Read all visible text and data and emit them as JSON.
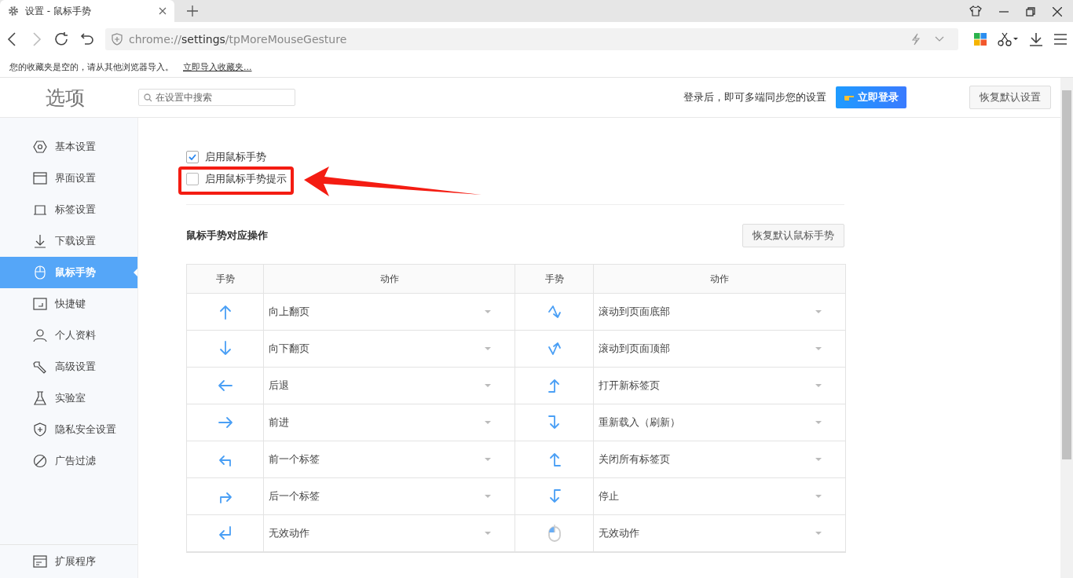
{
  "tab": {
    "title": "设置 - 鼠标手势"
  },
  "address": {
    "scheme": "chrome://",
    "host": "settings",
    "path": "/tpMoreMouseGesture"
  },
  "bookmarks_bar": {
    "message": "您的收藏夹是空的，请从其他浏览器导入。",
    "link": "立即导入收藏夹..."
  },
  "header": {
    "title": "选项",
    "search_placeholder": "在设置中搜索",
    "sync_text": "登录后，即可多端同步您的设置",
    "login_button": "立即登录",
    "reset_button": "恢复默认设置"
  },
  "sidebar": {
    "items": [
      {
        "label": "基本设置",
        "kind": "gear",
        "selected": false
      },
      {
        "label": "界面设置",
        "kind": "window",
        "selected": false
      },
      {
        "label": "标签设置",
        "kind": "tab",
        "selected": false
      },
      {
        "label": "下载设置",
        "kind": "download",
        "selected": false
      },
      {
        "label": "鼠标手势",
        "kind": "mouse",
        "selected": true
      },
      {
        "label": "快捷键",
        "kind": "keyboard",
        "selected": false
      },
      {
        "label": "个人资料",
        "kind": "user",
        "selected": false
      },
      {
        "label": "高级设置",
        "kind": "wrench",
        "selected": false
      },
      {
        "label": "实验室",
        "kind": "flask",
        "selected": false
      },
      {
        "label": "隐私安全设置",
        "kind": "shield",
        "selected": false
      },
      {
        "label": "广告过滤",
        "kind": "block",
        "selected": false
      }
    ],
    "footer": {
      "label": "扩展程序",
      "kind": "extension"
    }
  },
  "options": [
    {
      "label": "启用鼠标手势",
      "checked": true,
      "highlighted": false
    },
    {
      "label": "启用鼠标手势提示",
      "checked": false,
      "highlighted": true
    }
  ],
  "gestures": {
    "title": "鼠标手势对应操作",
    "reset_button": "恢复默认鼠标手势",
    "columns": [
      "手势",
      "动作",
      "手势",
      "动作"
    ],
    "rows": [
      [
        {
          "kind": "up",
          "action": "向上翻页"
        },
        {
          "kind": "zigzag-down",
          "action": "滚动到页面底部"
        }
      ],
      [
        {
          "kind": "down",
          "action": "向下翻页"
        },
        {
          "kind": "zigzag-up",
          "action": "滚动到页面顶部"
        }
      ],
      [
        {
          "kind": "left",
          "action": "后退"
        },
        {
          "kind": "right-up",
          "action": "打开新标签页"
        }
      ],
      [
        {
          "kind": "right",
          "action": "前进"
        },
        {
          "kind": "right-down",
          "action": "重新载入（刷新）"
        }
      ],
      [
        {
          "kind": "up-left",
          "action": "前一个标签"
        },
        {
          "kind": "left-up",
          "action": "关闭所有标签页"
        }
      ],
      [
        {
          "kind": "up-right",
          "action": "后一个标签"
        },
        {
          "kind": "left-down",
          "action": "停止"
        }
      ],
      [
        {
          "kind": "down-left",
          "action": "无效动作"
        },
        {
          "kind": "mouse",
          "action": "无效动作"
        }
      ]
    ]
  }
}
